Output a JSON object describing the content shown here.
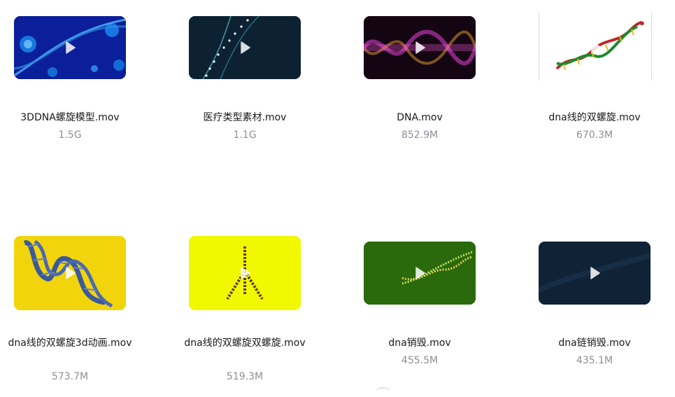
{
  "files": [
    {
      "name": "3DDNA螺旋模型.mov",
      "size": "1.5G"
    },
    {
      "name": "医疗类型素材.mov",
      "size": "1.1G"
    },
    {
      "name": "DNA.mov",
      "size": "852.9M"
    },
    {
      "name": "dna线的双螺旋.mov",
      "size": "670.3M"
    },
    {
      "name": "dna线的双螺旋3d动画.mov",
      "size": "573.7M"
    },
    {
      "name": "dna线的双螺旋双螺旋.mov",
      "size": "519.3M"
    },
    {
      "name": "dna销毁.mov",
      "size": "455.5M"
    },
    {
      "name": "dna链销毁.mov",
      "size": "435.1M"
    }
  ],
  "icons": {
    "play": "play-icon"
  }
}
